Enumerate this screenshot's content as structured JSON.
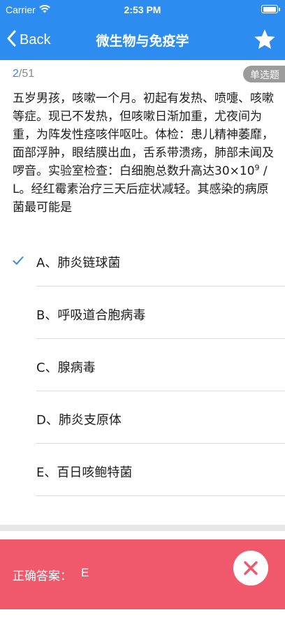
{
  "status_bar": {
    "carrier": "Carrier",
    "time": "2:53 PM"
  },
  "nav": {
    "back_label": "Back",
    "title": "微生物与免疫学"
  },
  "question": {
    "current": "2",
    "total": "/51",
    "type": "单选题",
    "stem_before": "五岁男孩，咳嗽一个月。初起有发热、喷嚏、咳嗽等症。现已不发热，但咳嗽日渐加重，尤夜间为重，为阵发性痉咳伴呕吐。体检：患儿精神萎靡，面部浮肿，眼结膜出血，舌系带溃疡，肺部未闻及啰音。实验室检查：白细胞总数升高达30×10",
    "stem_sup": "9",
    "stem_after": " / L。经红霉素治疗三天后症状减轻。其感染的病原菌最可能是"
  },
  "options": [
    {
      "label": "A、肺炎链球菌",
      "selected": true
    },
    {
      "label": "B、呼吸道合胞病毒",
      "selected": false
    },
    {
      "label": "C、腺病毒",
      "selected": false
    },
    {
      "label": "D、肺炎支原体",
      "selected": false
    },
    {
      "label": "E、百日咳鲍特菌",
      "selected": false
    }
  ],
  "answer": {
    "label": "正确答案：",
    "value": "E"
  },
  "colors": {
    "primary": "#2d8cf0",
    "answer_bar": "#f0586c",
    "badge": "#9b9b9b"
  },
  "icons": {
    "wifi": "wifi-icon",
    "battery": "battery-icon",
    "back": "chevron-left-icon",
    "star": "star-icon",
    "check": "checkmark-icon",
    "close": "close-icon"
  }
}
